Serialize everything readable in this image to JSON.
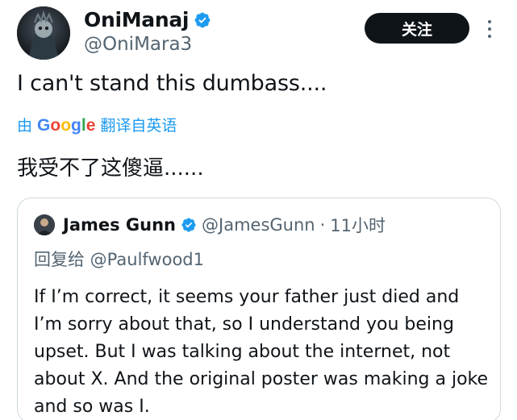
{
  "tweet": {
    "author_name": "OniManaj",
    "author_handle": "@OniMara3",
    "follow_label": "关注",
    "text": "I can't stand this dumbass....",
    "translate_prefix": "由",
    "translate_brand": "Google",
    "translate_suffix": "翻译自英语",
    "translated_text": "我受不了这傻逼......"
  },
  "quote": {
    "author_name": "James Gunn",
    "author_handle": "@JamesGunn",
    "separator": "·",
    "time": "11小时",
    "reply_to": "回复给 @Paulfwood1",
    "body_lines": [
      "If I’m correct, it seems your father just died and",
      "I’m sorry about that, so I understand you being",
      "upset. But I was talking about the internet, not",
      "about X. And the original poster was making a joke",
      "and so was I."
    ]
  },
  "colors": {
    "accent": "#1d9bf0",
    "text": "#0f1419",
    "secondary": "#536471",
    "follow_bg": "#0f1419",
    "border": "#cfd9de"
  },
  "icons": {
    "verified": "verified-badge-icon",
    "more": "more-vertical-icon"
  }
}
